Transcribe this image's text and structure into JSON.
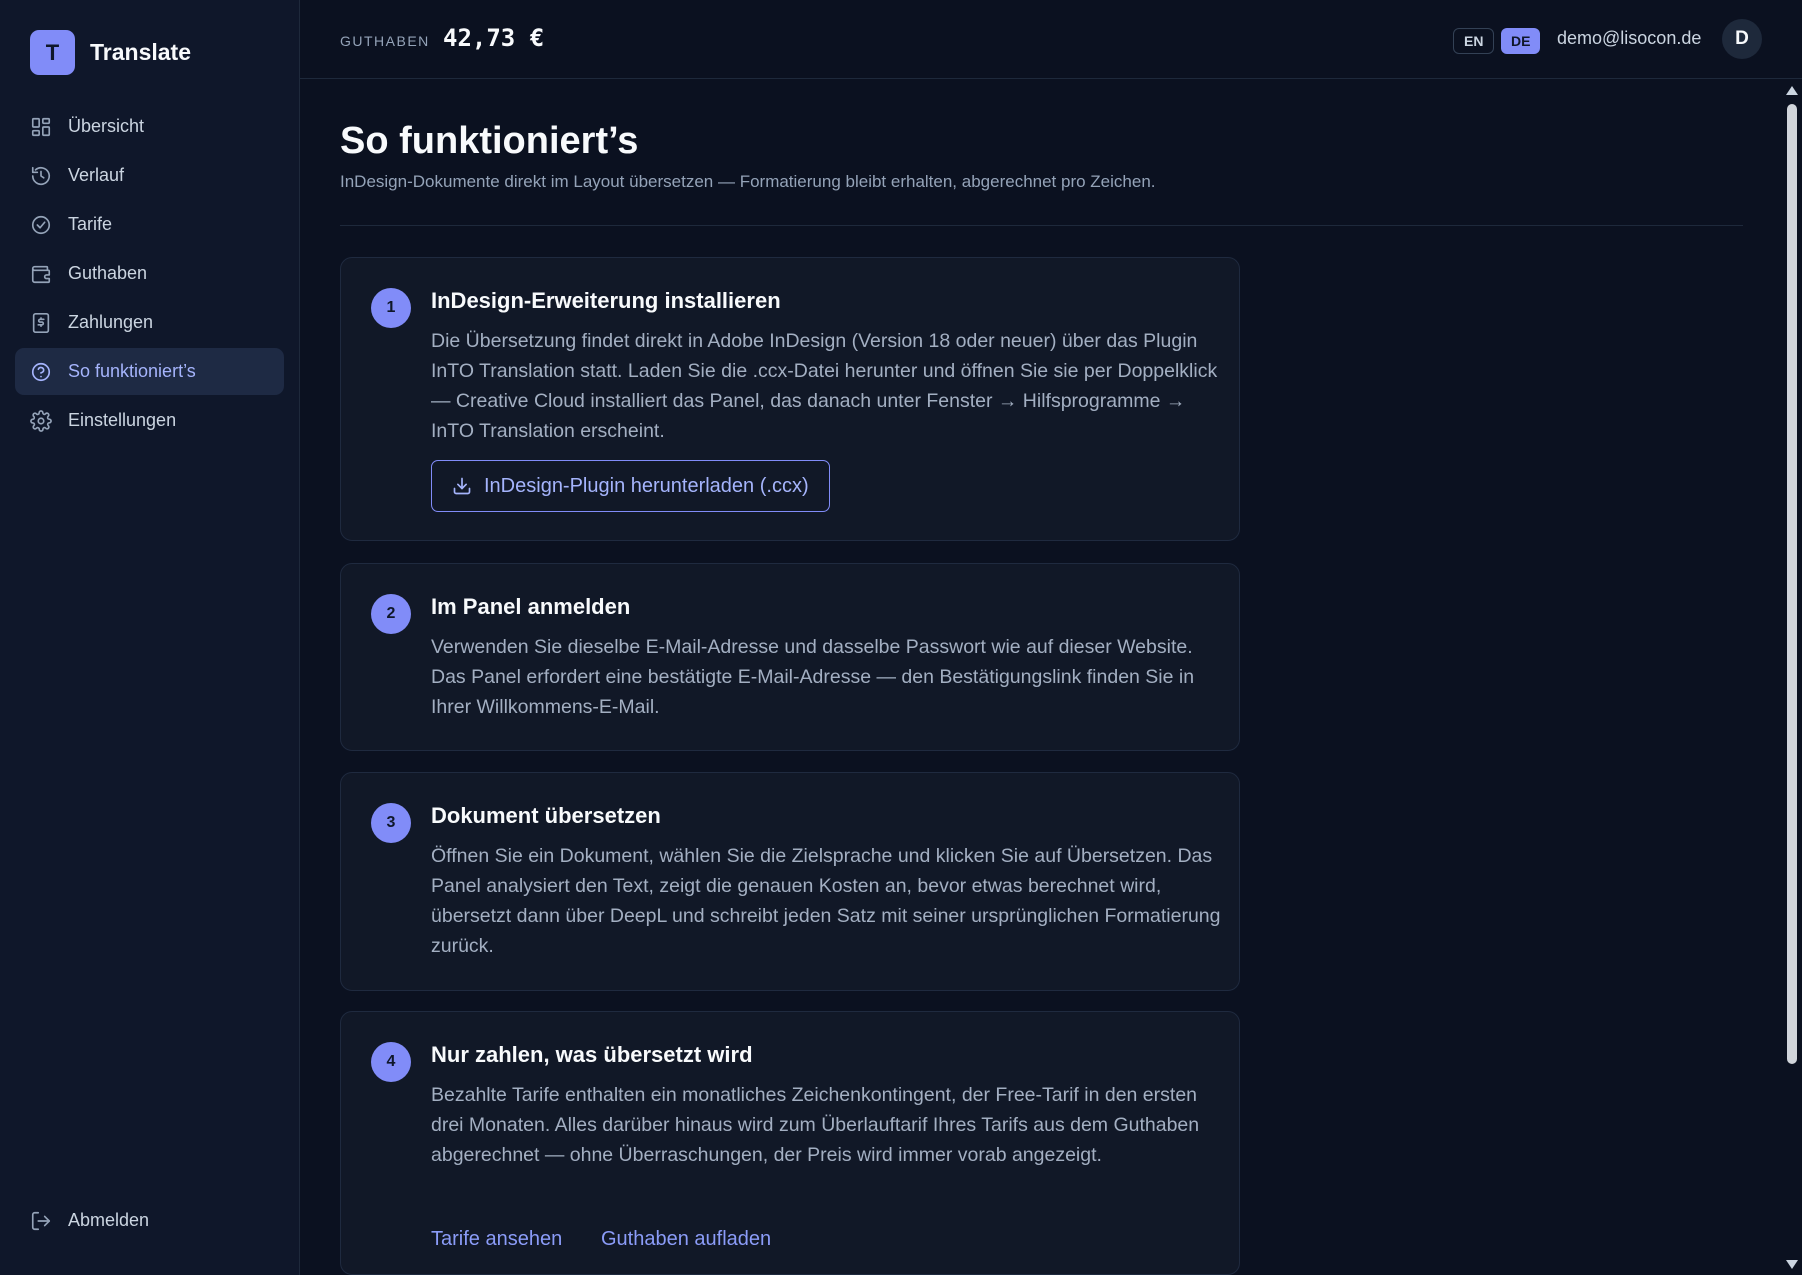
{
  "brand": {
    "logo_letter": "T",
    "name": "Translate"
  },
  "nav": {
    "items": [
      {
        "label": "Übersicht",
        "icon": "grid-icon"
      },
      {
        "label": "Verlauf",
        "icon": "history-icon"
      },
      {
        "label": "Tarife",
        "icon": "check-circle-icon"
      },
      {
        "label": "Guthaben",
        "icon": "wallet-icon"
      },
      {
        "label": "Zahlungen",
        "icon": "receipt-icon"
      },
      {
        "label": "So funktioniert’s",
        "icon": "help-circle-icon",
        "active": true
      },
      {
        "label": "Einstellungen",
        "icon": "gear-icon"
      }
    ],
    "logout_label": "Abmelden"
  },
  "topbar": {
    "balance_label": "GUTHABEN",
    "balance_value": "42,73 €",
    "lang_en": "EN",
    "lang_de": "DE",
    "active_lang": "DE",
    "user_email": "demo@lisocon.de",
    "avatar_letter": "D"
  },
  "page": {
    "title": "So funktioniert’s",
    "subtitle": "InDesign-Dokumente direkt im Layout übersetzen — Formatierung bleibt erhalten, abgerechnet pro Zeichen."
  },
  "steps": [
    {
      "number": "1",
      "title": "InDesign-Erweiterung installieren",
      "body": "Die Übersetzung findet direkt in Adobe InDesign (Version 18 oder neuer) über das Plugin InTO Translation statt. Laden Sie die .ccx-Datei herunter und öffnen Sie sie per Doppelklick — Creative Cloud installiert das Panel, das danach unter Fenster → Hilfsprogramme → InTO Translation erscheint.",
      "button_label": "InDesign-Plugin herunterladen (.ccx)"
    },
    {
      "number": "2",
      "title": "Im Panel anmelden",
      "body": "Verwenden Sie dieselbe E-Mail-Adresse und dasselbe Passwort wie auf dieser Website. Das Panel erfordert eine bestätigte E-Mail-Adresse — den Bestätigungslink finden Sie in Ihrer Willkommens-E-Mail."
    },
    {
      "number": "3",
      "title": "Dokument übersetzen",
      "body": "Öffnen Sie ein Dokument, wählen Sie die Zielsprache und klicken Sie auf Übersetzen. Das Panel analysiert den Text, zeigt die genauen Kosten an, bevor etwas berechnet wird, übersetzt dann über DeepL und schreibt jeden Satz mit seiner ursprünglichen Formatierung zurück."
    },
    {
      "number": "4",
      "title": "Nur zahlen, was übersetzt wird",
      "body": "Bezahlte Tarife enthalten ein monatliches Zeichenkontingent, der Free-Tarif in den ersten drei Monaten. Alles darüber hinaus wird zum Überlauftarif Ihres Tarifs aus dem Guthaben abgerechnet — ohne Überraschungen, der Preis wird immer vorab angezeigt.",
      "link_plans": "Tarife ansehen",
      "link_topup": "Guthaben aufladen"
    }
  ],
  "colors": {
    "accent": "#818cf8",
    "background": "#0b1120",
    "sidebar": "#0f172a",
    "card": "#111827"
  }
}
